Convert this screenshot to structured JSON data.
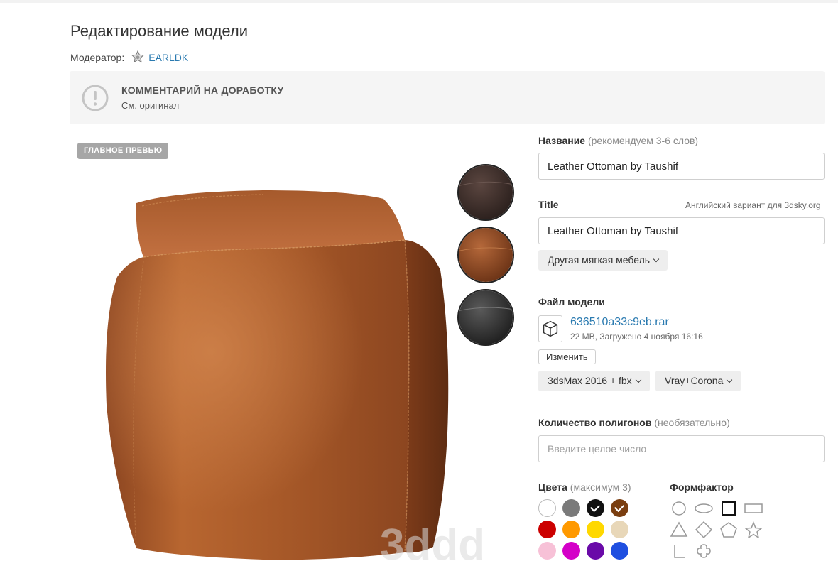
{
  "header": {
    "title": "Редактирование модели",
    "moderator_label": "Модератор:",
    "moderator_name": "EARLDK"
  },
  "notice": {
    "title": "КОММЕНТАРИЙ НА ДОРАБОТКУ",
    "text": "См. оригинал",
    "icon": "alert-circle-icon"
  },
  "preview": {
    "badge": "ГЛАВНОЕ ПРЕВЬЮ",
    "watermark": "3ddd",
    "thumbnails": [
      {
        "name": "dark-brown-leather",
        "color": "#3a2c28"
      },
      {
        "name": "tan-leather",
        "color": "#8a4a26"
      },
      {
        "name": "black-leather",
        "color": "#2a2a2a"
      }
    ]
  },
  "form": {
    "name_label": "Название",
    "name_hint": "(рекомендуем 3-6 слов)",
    "name_value": "Leather Ottoman by Taushif",
    "title_label": "Title",
    "title_hint": "Английский вариант для 3dsky.org",
    "title_value": "Leather Ottoman by Taushif",
    "category": "Другая мягкая мебель",
    "file_label": "Файл модели",
    "file_name": "636510a33c9eb.rar",
    "file_meta": "22 MB, Загружено 4 ноября 16:16",
    "change_label": "Изменить",
    "format": "3dsMax 2016 + fbx",
    "renderer": "Vray+Corona",
    "polygons_label": "Количество полигонов",
    "polygons_hint": "(необязательно)",
    "polygons_placeholder": "Введите целое число",
    "colors_label": "Цвета",
    "colors_hint": "(максимум 3)",
    "formfactor_label": "Формфактор"
  },
  "colors": [
    {
      "name": "white",
      "hex": "#ffffff",
      "selected": false
    },
    {
      "name": "gray",
      "hex": "#7a7a7a",
      "selected": false
    },
    {
      "name": "black",
      "hex": "#111111",
      "selected": true
    },
    {
      "name": "brown",
      "hex": "#7a3e10",
      "selected": true
    },
    {
      "name": "red",
      "hex": "#cc0000",
      "selected": false
    },
    {
      "name": "orange",
      "hex": "#ff9900",
      "selected": false
    },
    {
      "name": "yellow",
      "hex": "#ffd800",
      "selected": false
    },
    {
      "name": "beige",
      "hex": "#e8d7b8",
      "selected": false
    },
    {
      "name": "pink",
      "hex": "#f7c1d7",
      "selected": false
    },
    {
      "name": "magenta",
      "hex": "#d400c8",
      "selected": false
    },
    {
      "name": "purple",
      "hex": "#6a0aa8",
      "selected": false
    },
    {
      "name": "blue",
      "hex": "#1f4fe0",
      "selected": false
    }
  ],
  "shapes": [
    {
      "name": "circle",
      "selected": false
    },
    {
      "name": "oval",
      "selected": false
    },
    {
      "name": "square",
      "selected": true
    },
    {
      "name": "rectangle",
      "selected": false
    },
    {
      "name": "triangle",
      "selected": false
    },
    {
      "name": "diamond",
      "selected": false
    },
    {
      "name": "pentagon",
      "selected": false
    },
    {
      "name": "star",
      "selected": false
    },
    {
      "name": "corner",
      "selected": false
    },
    {
      "name": "flower",
      "selected": false
    }
  ]
}
